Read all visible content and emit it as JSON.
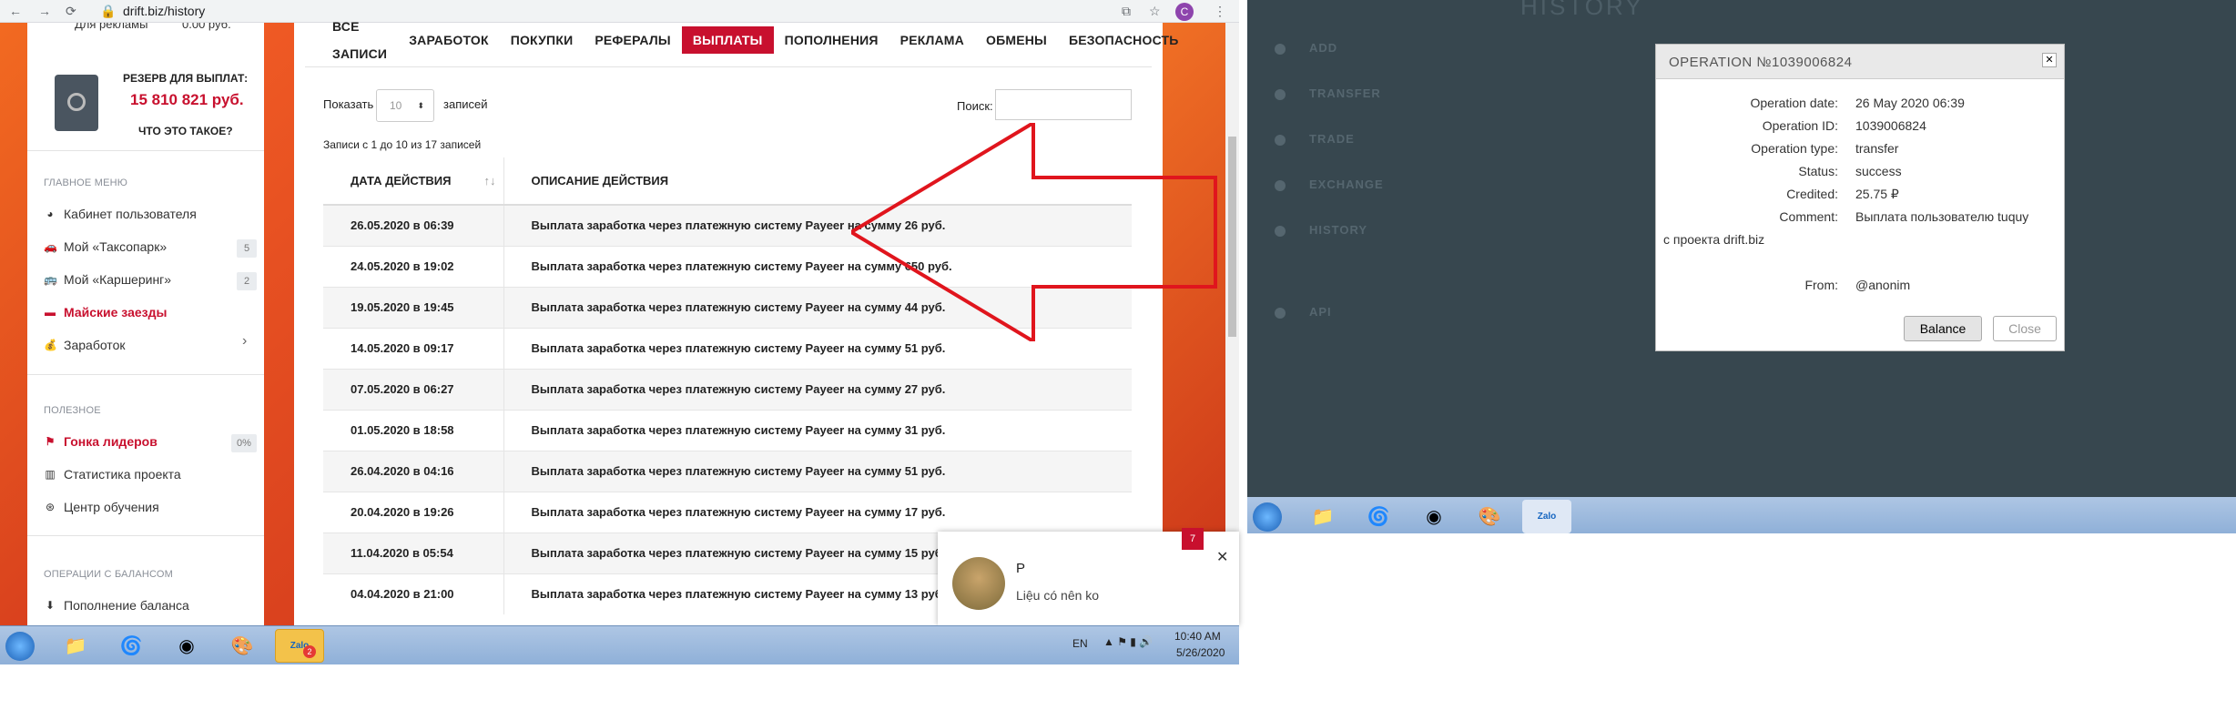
{
  "browser": {
    "url": "drift.biz/history",
    "avatar_letter": "C"
  },
  "sidebar": {
    "top_cut": "Для рекламы",
    "top_cut_val": "0.00 руб.",
    "reserve_label": "РЕЗЕРВ ДЛЯ ВЫПЛАТ:",
    "reserve_value": "15 810 821 руб.",
    "reserve_link": "ЧТО ЭТО ТАКОЕ?",
    "sec1": "ГЛАВНОЕ МЕНЮ",
    "items1": [
      {
        "label": "Кабинет пользователя"
      },
      {
        "label": "Мой «Таксопарк»",
        "count": "5"
      },
      {
        "label": "Мой «Каршеринг»",
        "count": "2"
      },
      {
        "label": "Майские заезды"
      },
      {
        "label": "Заработок",
        "arrow": "›"
      }
    ],
    "sec2": "ПОЛЕЗНОЕ",
    "items2": [
      {
        "label": "Гонка лидеров",
        "count": "0%"
      },
      {
        "label": "Статистика проекта"
      },
      {
        "label": "Центр обучения"
      }
    ],
    "sec3": "ОПЕРАЦИИ С БАЛАНСОМ",
    "items3": [
      {
        "label": "Пополнение баланса"
      }
    ]
  },
  "tabs": [
    "ВСЕ ЗАПИСИ",
    "ЗАРАБОТОК",
    "ПОКУПКИ",
    "РЕФЕРАЛЫ",
    "ВЫПЛАТЫ",
    "ПОПОЛНЕНИЯ",
    "РЕКЛАМА",
    "ОБМЕНЫ",
    "БЕЗОПАСНОСТЬ"
  ],
  "controls": {
    "show_label": "Показать",
    "show_value": "10",
    "records_label": "записей",
    "search_label": "Поиск:",
    "info": "Записи с 1 до 10 из 17 записей"
  },
  "table": {
    "headers": [
      "ДАТА ДЕЙСТВИЯ",
      "ОПИСАНИЕ ДЕЙСТВИЯ"
    ],
    "rows": [
      [
        "26.05.2020 в 06:39",
        "Выплата заработка через платежную систему Payeer на сумму 26 руб."
      ],
      [
        "24.05.2020 в 19:02",
        "Выплата заработка через платежную систему Payeer на сумму 650 руб."
      ],
      [
        "19.05.2020 в 19:45",
        "Выплата заработка через платежную систему Payeer на сумму 44 руб."
      ],
      [
        "14.05.2020 в 09:17",
        "Выплата заработка через платежную систему Payeer на сумму 51 руб."
      ],
      [
        "07.05.2020 в 06:27",
        "Выплата заработка через платежную систему Payeer на сумму 27 руб."
      ],
      [
        "01.05.2020 в 18:58",
        "Выплата заработка через платежную систему Payeer на сумму 31 руб."
      ],
      [
        "26.04.2020 в 04:16",
        "Выплата заработка через платежную систему Payeer на сумму 51 руб."
      ],
      [
        "20.04.2020 в 19:26",
        "Выплата заработка через платежную систему Payeer на сумму 17 руб."
      ],
      [
        "11.04.2020 в 05:54",
        "Выплата заработка через платежную систему Payeer на сумму 15 руб."
      ],
      [
        "04.04.2020 в 21:00",
        "Выплата заработка через платежную систему Payeer на сумму 13 руб."
      ]
    ]
  },
  "chat": {
    "name": "P",
    "message": "Liệu có nên ko",
    "badge": "7"
  },
  "taskbar": {
    "lang": "EN",
    "time": "10:40 AM",
    "date": "5/26/2020",
    "zalo": "Zalo",
    "zalo_badge": "2"
  },
  "right": {
    "title_bg": "HISTORY",
    "nav": [
      "ADD",
      "TRANSFER",
      "TRADE",
      "EXCHANGE",
      "HISTORY",
      "API"
    ],
    "modal": {
      "title": "OPERATION №1039006824",
      "rows": [
        {
          "label": "Operation date:",
          "value": "26 May 2020 06:39"
        },
        {
          "label": "Operation ID:",
          "value": "1039006824"
        },
        {
          "label": "Operation type:",
          "value": "transfer"
        },
        {
          "label": "Status:",
          "value": "success"
        },
        {
          "label": "Credited:",
          "value": "25.75 ₽"
        },
        {
          "label": "Comment:",
          "value": "Выплата пользователю tuquy"
        }
      ],
      "comment_cont": "с проекта drift.biz",
      "from_label": "From:",
      "from_value": "@anonim",
      "btn_balance": "Balance",
      "btn_close": "Close"
    }
  },
  "colors": {
    "accent": "#c8102e",
    "arrow": "#e0151d",
    "panel": "#37474f"
  }
}
